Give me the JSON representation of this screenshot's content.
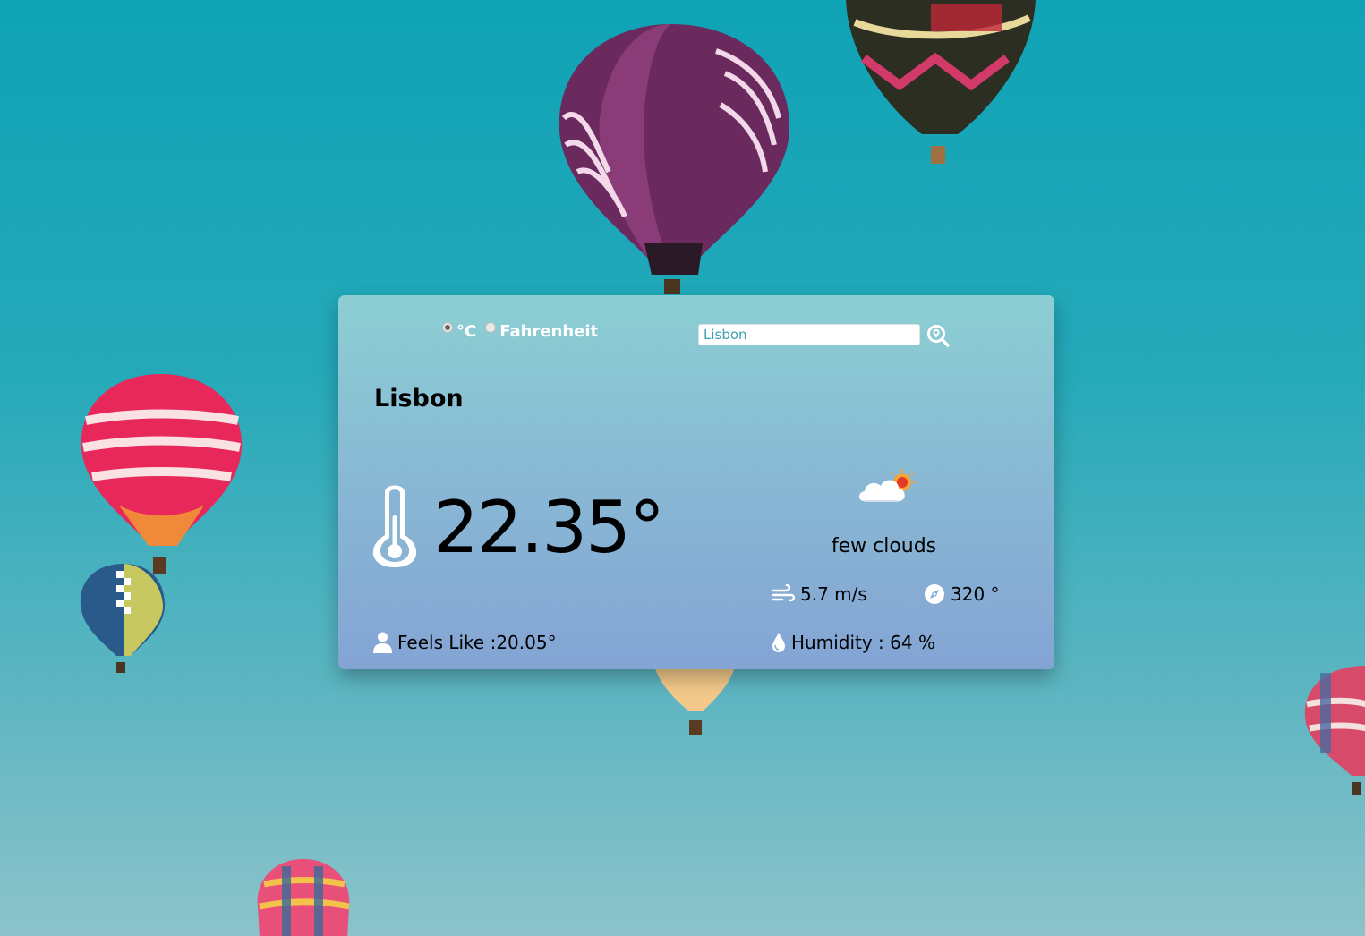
{
  "units": {
    "celsius_label": "°C",
    "fahrenheit_label": "Fahrenheit",
    "selected": "celsius"
  },
  "search": {
    "value": "Lisbon"
  },
  "weather": {
    "city": "Lisbon",
    "temperature": "22.35°",
    "description": "few clouds",
    "wind_speed": "5.7 m/s",
    "wind_direction": "320 °",
    "feels_like": "Feels Like :20.05°",
    "humidity": "Humidity : 64 %"
  },
  "icons": {
    "search": "search-icon",
    "thermometer": "thermometer-icon",
    "weather": "cloud-sun-icon",
    "wind": "wind-icon",
    "compass": "compass-icon",
    "person": "person-icon",
    "humidity": "water-drop-icon"
  },
  "colors": {
    "sky_top": "#0fa3b6",
    "card_top": "#8ccfd3",
    "card_bottom": "#84a4d4",
    "text": "#ffffff",
    "input_text": "#3a9fb0"
  }
}
